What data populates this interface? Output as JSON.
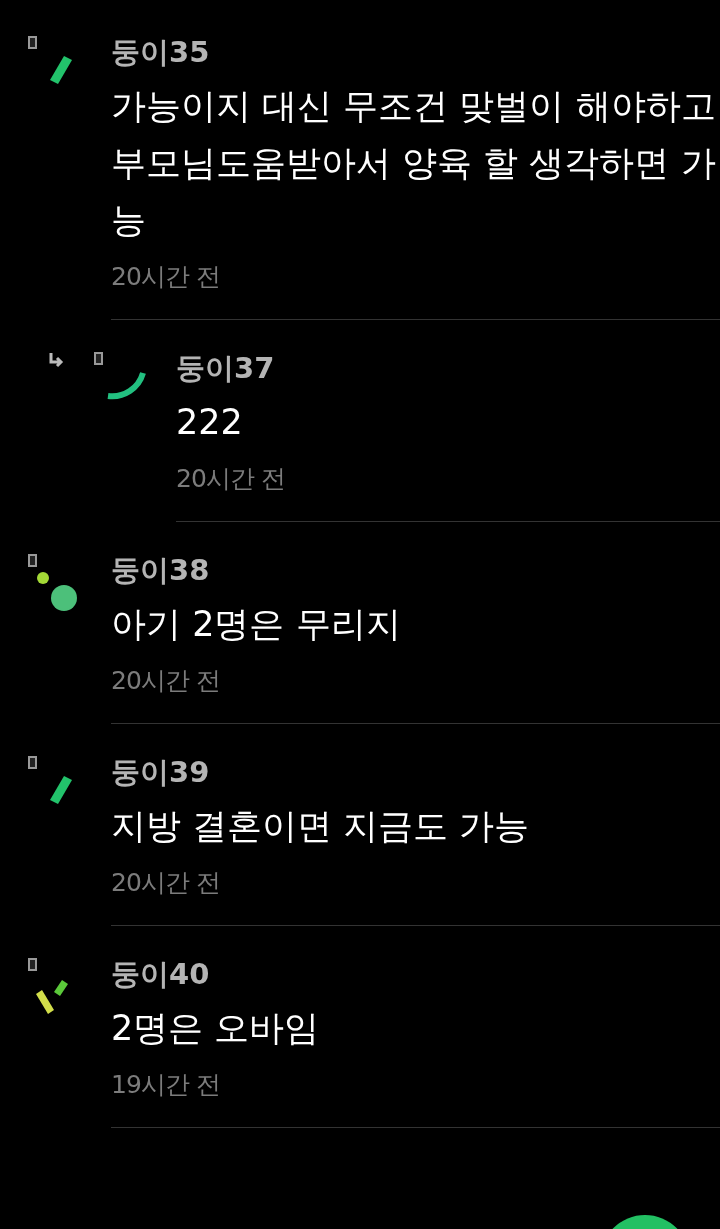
{
  "comments": [
    {
      "author": "둥이35",
      "text": "가능이지 대신 무조건 맞벌이 해야하고 부모님도움받아서 양육 할 생각하면 가능",
      "time": "20시간 전",
      "reply": false,
      "avatar": {
        "kind": "bar"
      }
    },
    {
      "author": "둥이37",
      "text": "222",
      "time": "20시간 전",
      "reply": true,
      "avatar": {
        "kind": "arc"
      }
    },
    {
      "author": "둥이38",
      "text": "아기 2명은 무리지",
      "time": "20시간 전",
      "reply": false,
      "avatar": {
        "kind": "dots"
      }
    },
    {
      "author": "둥이39",
      "text": "지방 결혼이면 지금도 가능",
      "time": "20시간 전",
      "reply": false,
      "avatar": {
        "kind": "bar"
      }
    },
    {
      "author": "둥이40",
      "text": "2명은 오바임",
      "time": "19시간 전",
      "reply": false,
      "avatar": {
        "kind": "sticks"
      }
    }
  ]
}
